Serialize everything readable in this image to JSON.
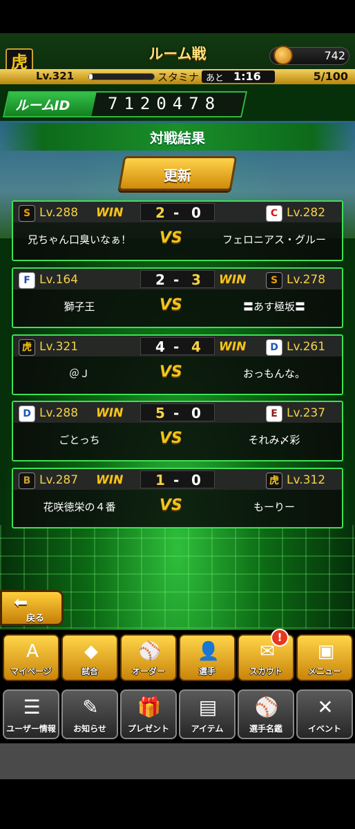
{
  "header": {
    "team_logo": "虎",
    "title": "ルーム戦",
    "coin_icon": "coin-icon",
    "coins": "742",
    "level": "Lv.321",
    "stamina_label": "スタミナ",
    "stamina_fraction": 0.05,
    "ato_label": "あと",
    "time": "1:16",
    "stamina_count": "5/100"
  },
  "room": {
    "label": "ルームID",
    "id": "7120478"
  },
  "section": {
    "title": "対戦結果",
    "refresh_label": "更新"
  },
  "matches": [
    {
      "left_icon": "S",
      "left_icon_color": "#e8a000",
      "left_lv": "Lv.288",
      "left_win": "WIN",
      "score_left": "2",
      "dash": "-",
      "score_right": "0",
      "right_win": "",
      "right_icon": "C",
      "right_icon_color": "#d7141a",
      "right_lv": "Lv.282",
      "left_name": "兄ちゃん口臭いなぁ！",
      "vs": "VS",
      "right_name": "フェロニアス・グルー"
    },
    {
      "left_icon": "F",
      "left_icon_color": "#1f4ea0",
      "left_lv": "Lv.164",
      "left_win": "",
      "score_left": "2",
      "dash": "-",
      "score_right": "3",
      "right_win": "WIN",
      "right_icon": "S",
      "right_icon_color": "#e8a000",
      "right_lv": "Lv.278",
      "left_name": "獅子王",
      "vs": "VS",
      "right_name": "〓あす極坂〓"
    },
    {
      "left_icon": "虎",
      "left_icon_color": "#f2c318",
      "left_lv": "Lv.321",
      "left_win": "",
      "score_left": "4",
      "dash": "-",
      "score_right": "4",
      "right_win": "WIN",
      "right_icon": "D",
      "right_icon_color": "#1d56b8",
      "right_lv": "Lv.261",
      "left_name": "＠Ｊ",
      "vs": "VS",
      "right_name": "おっもんな。"
    },
    {
      "left_icon": "D",
      "left_icon_color": "#1d56b8",
      "left_lv": "Lv.288",
      "left_win": "WIN",
      "score_left": "5",
      "dash": "-",
      "score_right": "0",
      "right_win": "",
      "right_icon": "E",
      "right_icon_color": "#8a1a1a",
      "right_lv": "Lv.237",
      "left_name": "ごとっち",
      "vs": "VS",
      "right_name": "それみ〆彩"
    },
    {
      "left_icon": "B",
      "left_icon_color": "#c9a22c",
      "left_lv": "Lv.287",
      "left_win": "WIN",
      "score_left": "1",
      "dash": "-",
      "score_right": "0",
      "right_win": "",
      "right_icon": "虎",
      "right_icon_color": "#f2c318",
      "right_lv": "Lv.312",
      "left_name": "花咲徳栄の４番",
      "vs": "VS",
      "right_name": "もーりー"
    }
  ],
  "back": {
    "label": "戻る",
    "icon": "back-arrow-icon"
  },
  "nav_primary": [
    {
      "label": "マイページ",
      "icon": "A",
      "icon_name": "mypage-icon"
    },
    {
      "label": "試合",
      "icon": "◆",
      "icon_name": "stadium-icon"
    },
    {
      "label": "オーダー",
      "icon": "⚾",
      "icon_name": "order-icon"
    },
    {
      "label": "選手",
      "icon": "👤",
      "icon_name": "player-icon"
    },
    {
      "label": "スカウト",
      "icon": "✉",
      "icon_name": "scout-icon"
    },
    {
      "label": "メニュー",
      "icon": "▣",
      "icon_name": "menu-icon"
    }
  ],
  "scout_badge": "!",
  "nav_secondary": [
    {
      "label": "ユーザー情報",
      "icon": "☰",
      "icon_name": "user-info-icon"
    },
    {
      "label": "お知らせ",
      "icon": "✎",
      "icon_name": "notice-icon"
    },
    {
      "label": "プレゼント",
      "icon": "🎁",
      "icon_name": "present-icon"
    },
    {
      "label": "アイテム",
      "icon": "▤",
      "icon_name": "item-icon"
    },
    {
      "label": "選手名鑑",
      "icon": "⚾",
      "icon_name": "player-directory-icon"
    },
    {
      "label": "イベント",
      "icon": "✕",
      "icon_name": "event-icon"
    }
  ]
}
